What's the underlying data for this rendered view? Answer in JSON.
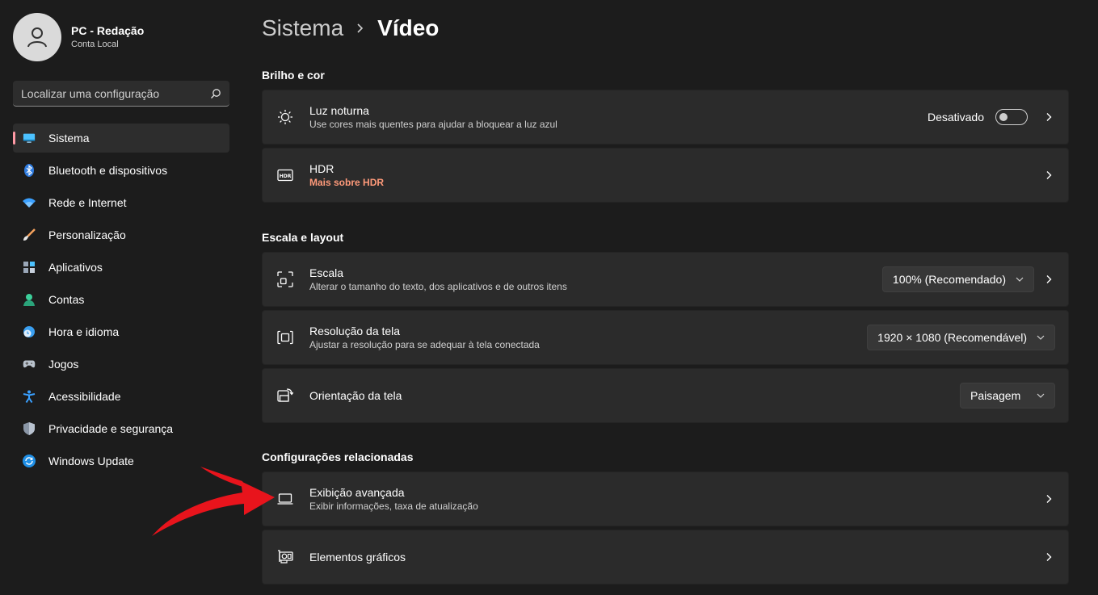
{
  "profile": {
    "name": "PC - Redação",
    "account": "Conta Local"
  },
  "search": {
    "placeholder": "Localizar uma configuração"
  },
  "nav": {
    "items": [
      {
        "label": "Sistema",
        "icon": "monitor-icon",
        "active": true
      },
      {
        "label": "Bluetooth e dispositivos",
        "icon": "bluetooth-icon"
      },
      {
        "label": "Rede e Internet",
        "icon": "wifi-icon"
      },
      {
        "label": "Personalização",
        "icon": "brush-icon"
      },
      {
        "label": "Aplicativos",
        "icon": "apps-icon"
      },
      {
        "label": "Contas",
        "icon": "person-icon"
      },
      {
        "label": "Hora e idioma",
        "icon": "clock-globe-icon"
      },
      {
        "label": "Jogos",
        "icon": "gamepad-icon"
      },
      {
        "label": "Acessibilidade",
        "icon": "accessibility-icon"
      },
      {
        "label": "Privacidade e segurança",
        "icon": "shield-icon"
      },
      {
        "label": "Windows Update",
        "icon": "update-icon"
      }
    ]
  },
  "header": {
    "parent": "Sistema",
    "current": "Vídeo"
  },
  "sections": {
    "brightness": "Brilho e cor",
    "scale_layout": "Escala e layout",
    "related": "Configurações relacionadas"
  },
  "cards": {
    "night_light": {
      "title": "Luz noturna",
      "subtitle": "Use cores mais quentes para ajudar a bloquear a luz azul",
      "toggle_label": "Desativado",
      "toggle_on": false
    },
    "hdr": {
      "title": "HDR",
      "link": "Mais sobre HDR"
    },
    "scale": {
      "title": "Escala",
      "subtitle": "Alterar o tamanho do texto, dos aplicativos e de outros itens",
      "value": "100% (Recomendado)"
    },
    "resolution": {
      "title": "Resolução da tela",
      "subtitle": "Ajustar a resolução para se adequar à tela conectada",
      "value": "1920 × 1080 (Recomendável)"
    },
    "orientation": {
      "title": "Orientação da tela",
      "value": "Paisagem"
    },
    "advanced": {
      "title": "Exibição avançada",
      "subtitle": "Exibir informações, taxa de atualização"
    },
    "graphics": {
      "title": "Elementos gráficos"
    }
  },
  "colors": {
    "background": "#1c1c1c",
    "card": "#2b2b2b",
    "accent": "#ff99a4",
    "link": "#ff9a7a",
    "annotation_arrow": "#e8141c"
  }
}
